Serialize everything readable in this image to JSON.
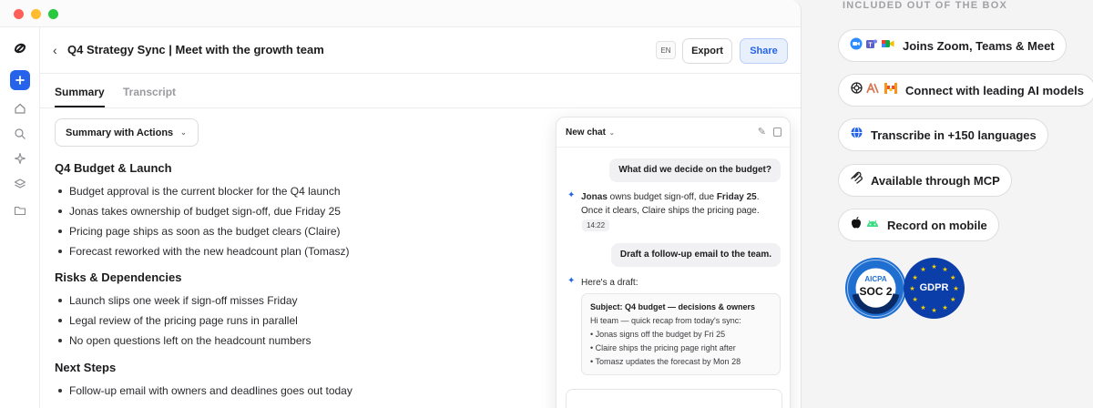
{
  "window": {
    "title": "Q4 Strategy Sync | Meet with the growth team",
    "language": "EN",
    "export_label": "Export",
    "share_label": "Share",
    "tabs": [
      "Summary",
      "Transcript"
    ],
    "view_select": "Summary with Actions"
  },
  "summary": {
    "sections": [
      {
        "heading": "Q4 Budget & Launch",
        "items": [
          "Budget approval is the current blocker for the Q4 launch",
          "Jonas takes ownership of budget sign-off, due Friday 25",
          "Pricing page ships as soon as the budget clears (Claire)",
          "Forecast reworked with the new headcount plan (Tomasz)"
        ]
      },
      {
        "heading": "Risks & Dependencies",
        "items": [
          "Launch slips one week if sign-off misses Friday",
          "Legal review of the pricing page runs in parallel",
          "No open questions left on the headcount numbers"
        ]
      },
      {
        "heading": "Next Steps",
        "items": [
          "Follow-up email with owners and deadlines goes out today"
        ]
      }
    ]
  },
  "chat": {
    "title": "New chat",
    "user_msg_1": "What did we decide on the budget?",
    "ai_reply_1": {
      "owner": "Jonas",
      "mid": " owns budget sign-off, due ",
      "due": "Friday 25",
      "rest": ". Once it clears, Claire ships the pricing page."
    },
    "time": "14:22",
    "user_msg_2": "Draft a follow-up email to the team.",
    "ai_reply_2": "Here's a draft:",
    "draft": {
      "subject": "Subject: Q4 budget — decisions & owners",
      "lines": [
        "Hi team — quick recap from today's sync:",
        "• Jonas signs off the budget by Fri 25",
        "• Claire ships the pricing page right after",
        "• Tomasz updates the forecast by Mon 28"
      ]
    }
  },
  "features": {
    "heading": "INCLUDED OUT OF THE BOX",
    "items": [
      {
        "label": "Joins Zoom, Teams & Meet",
        "icons": [
          "zoom-icon",
          "teams-icon",
          "meet-icon"
        ]
      },
      {
        "label": "Connect with leading AI models",
        "icons": [
          "openai-icon",
          "anthropic-icon",
          "mistral-icon"
        ]
      },
      {
        "label": "Transcribe in +150 languages",
        "icons": [
          "globe-icon"
        ]
      },
      {
        "label": "Available through MCP",
        "icons": [
          "mcp-icon"
        ]
      },
      {
        "label": "Record on mobile",
        "icons": [
          "apple-icon",
          "android-icon"
        ]
      }
    ],
    "badges": {
      "soc_top": "AICPA",
      "soc_main": "SOC 2",
      "gdpr": "GDPR"
    }
  },
  "colors": {
    "accent": "#2563eb",
    "soc_blue": "#1f6fd1",
    "gdpr_blue": "#0b3ea8",
    "gdpr_stars": "#f5d000"
  }
}
